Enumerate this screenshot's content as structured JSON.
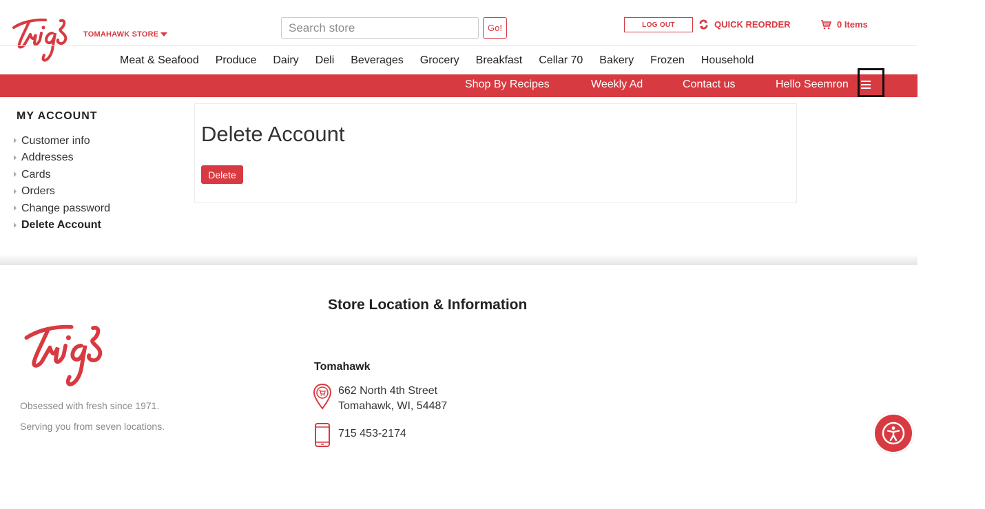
{
  "header": {
    "store_name": "TOMAHAWK STORE",
    "search_placeholder": "Search store",
    "go_label": "Go!",
    "logout_label": "LOG OUT",
    "quick_reorder_label": "QUICK REORDER",
    "cart_label": "0 Items"
  },
  "main_nav": [
    "Meat & Seafood",
    "Produce",
    "Dairy",
    "Deli",
    "Beverages",
    "Grocery",
    "Breakfast",
    "Cellar 70",
    "Bakery",
    "Frozen",
    "Household"
  ],
  "red_nav": {
    "shop_by_recipes": "Shop By Recipes",
    "weekly_ad": "Weekly Ad",
    "contact_us": "Contact us",
    "hello_user": "Hello Seemron"
  },
  "account_menu": {
    "heading": "MY ACCOUNT",
    "items": [
      "Customer info",
      "Addresses",
      "Cards",
      "Orders",
      "Change password",
      "Delete Account"
    ],
    "active": "Delete Account"
  },
  "main": {
    "title": "Delete Account",
    "delete_label": "Delete"
  },
  "footer": {
    "tagline_1": "Obsessed with fresh since  1971.",
    "tagline_2": "Serving you from seven locations.",
    "heading": "Store Location & Information",
    "store_name": "Tomahawk",
    "address_line_1": "662 North 4th Street",
    "address_line_2": "Tomahawk, WI, 54487",
    "phone": "715 453-2174"
  },
  "colors": {
    "brand_red": "#d83a41"
  },
  "icons": {
    "logo": "trigs-logo",
    "quick_reorder": "refresh-icon",
    "cart": "cart-icon",
    "menu": "hamburger-icon",
    "location": "location-pin-icon",
    "phone": "phone-icon",
    "accessibility": "accessibility-icon"
  }
}
